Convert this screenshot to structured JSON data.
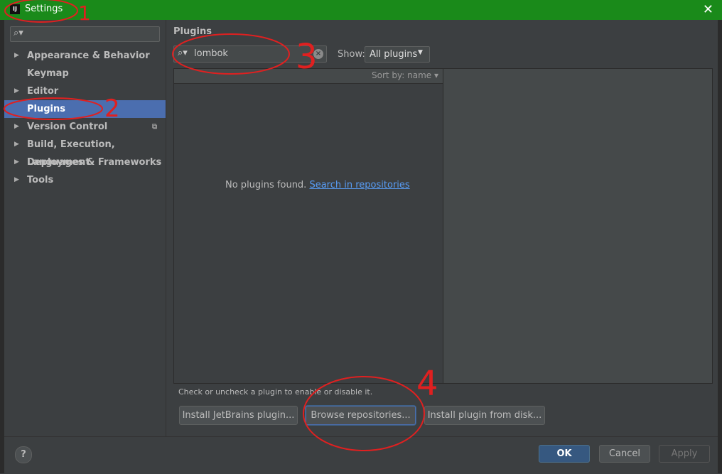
{
  "window": {
    "title": "Settings",
    "app_icon": "IJ"
  },
  "sidebar": {
    "search": {
      "value": ""
    },
    "items": [
      {
        "label": "Appearance & Behavior",
        "expandable": true
      },
      {
        "label": "Keymap",
        "expandable": false
      },
      {
        "label": "Editor",
        "expandable": true
      },
      {
        "label": "Plugins",
        "expandable": false,
        "selected": true
      },
      {
        "label": "Version Control",
        "expandable": true
      },
      {
        "label": "Build, Execution, Deployment",
        "expandable": true
      },
      {
        "label": "Languages & Frameworks",
        "expandable": true
      },
      {
        "label": "Tools",
        "expandable": true
      }
    ]
  },
  "main": {
    "heading": "Plugins",
    "search": {
      "value": "lombok"
    },
    "show": {
      "label": "Show:",
      "selected": "All plugins"
    },
    "sort_label": "Sort by: name ▾",
    "empty_text": "No plugins found.",
    "empty_link": "Search in repositories",
    "hint": "Check or uncheck a plugin to enable or disable it.",
    "buttons": {
      "install_jetbrains": "Install JetBrains plugin...",
      "browse_repositories": "Browse repositories...",
      "install_from_disk": "Install plugin from disk..."
    }
  },
  "footer": {
    "help": "?",
    "ok": "OK",
    "cancel": "Cancel",
    "apply": "Apply"
  },
  "annotations": {
    "one": "1",
    "two": "2",
    "three": "3",
    "four": "4"
  },
  "colors": {
    "titlebar": "#1a8a1a",
    "selection": "#4b6eaf",
    "annotation": "#e02020",
    "link": "#589df6"
  }
}
